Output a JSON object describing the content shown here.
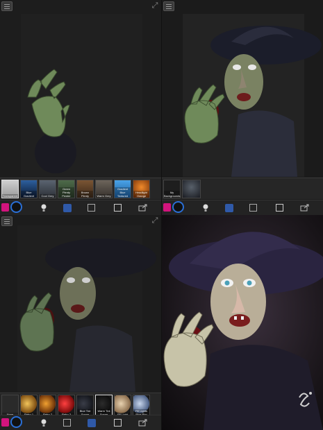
{
  "panels": {
    "top_right_strip_label": "My Backgrounds",
    "top_left": {
      "backgrounds": [
        {
          "label": "Transparent",
          "color1": "#cfcfcf",
          "color2": "#9a9a9a",
          "selected": true
        },
        {
          "label": "Blue Gradient",
          "color1": "#2d5f9e",
          "color2": "#0b1a33",
          "selected": false
        },
        {
          "label": "Cool Grey",
          "color1": "#5a6370",
          "color2": "#2c3036",
          "selected": false
        },
        {
          "label": "Green Plenty Pewter",
          "color1": "#4e6a4a",
          "color2": "#293b27",
          "selected": false
        },
        {
          "label": "Brown Plenty",
          "color1": "#7a5534",
          "color2": "#3b2818",
          "selected": false
        },
        {
          "label": "Warm Grey",
          "color1": "#6d645b",
          "color2": "#35312c",
          "selected": false
        },
        {
          "label": "Gradient Blue Textured",
          "color1": "#4aa3e8",
          "color2": "#1a5c9c",
          "selected": false
        },
        {
          "label": "Headlight Orange",
          "color1": "#f08a2b",
          "color2": "#6b2a06",
          "selected": false
        }
      ]
    },
    "bottom_left": {
      "lights": [
        {
          "label": "None",
          "color1": "#2a2a2a",
          "color2": "#222222",
          "selected": false
        },
        {
          "label": "Retro 1",
          "color1": "#f2c45a",
          "color2": "#7a4a10",
          "selected": false
        },
        {
          "label": "Retro 2",
          "color1": "#f0a030",
          "color2": "#6a3008",
          "selected": false
        },
        {
          "label": "Retro 3",
          "color1": "#ff4040",
          "color2": "#7a0a0a",
          "selected": false
        },
        {
          "label": "Blue Tint Scene",
          "color1": "#3a3d48",
          "color2": "#15171d",
          "selected": false
        },
        {
          "label": "Warm Tint Scene",
          "color1": "#2c2c2c",
          "color2": "#0e0e0e",
          "selected": true
        },
        {
          "label": "Fill Light",
          "color1": "#e8d2b0",
          "color2": "#8a6c4c",
          "selected": false
        },
        {
          "label": "Fill Lights Blue Rim",
          "color1": "#c8d6ec",
          "color2": "#4a5e84",
          "selected": false
        }
      ]
    }
  },
  "icons": {
    "menu": "menu-icon",
    "expand": "expand-icon",
    "light": "bulb-icon",
    "layers": "layers-icon",
    "image": "image-icon",
    "share": "share-icon"
  },
  "colors": {
    "accent": "#2a6fd6",
    "logo": "#d2147d"
  }
}
